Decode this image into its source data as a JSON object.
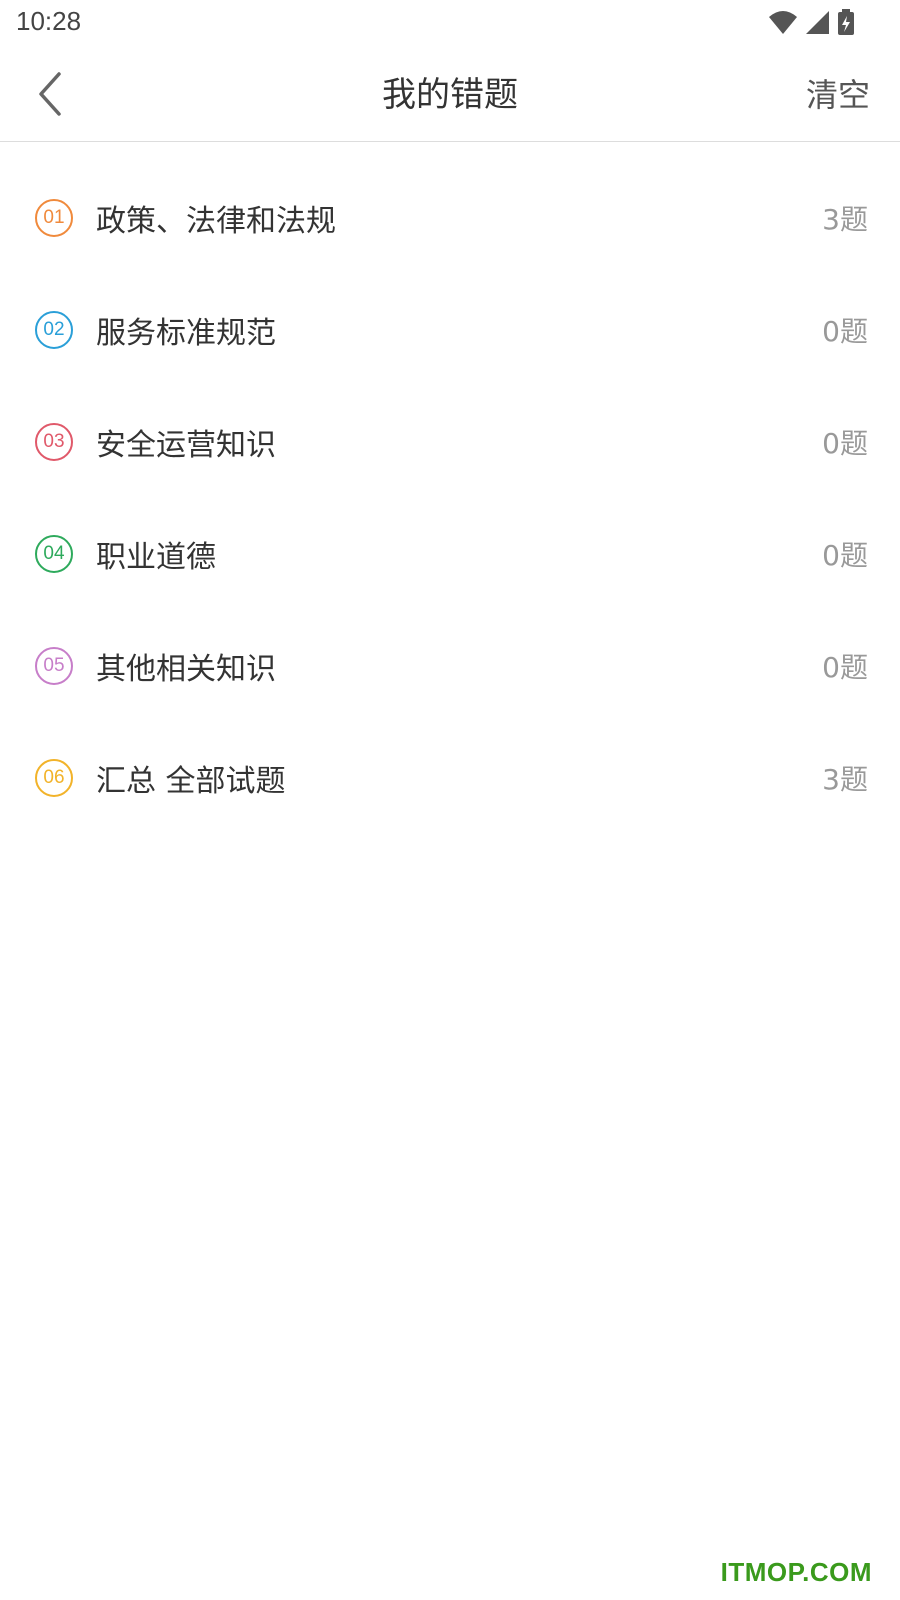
{
  "status_bar": {
    "time": "10:28",
    "icons": [
      "wifi-icon",
      "signal-icon",
      "battery-charging-icon"
    ]
  },
  "header": {
    "title": "我的错题",
    "back_icon": "chevron-left-icon",
    "clear_label": "清空"
  },
  "categories": [
    {
      "number": "01",
      "label": "政策、法律和法规",
      "count": "3题",
      "color": "#f08a3c"
    },
    {
      "number": "02",
      "label": "服务标准规范",
      "count": "0题",
      "color": "#2a9fd8"
    },
    {
      "number": "03",
      "label": "安全运营知识",
      "count": "0题",
      "color": "#e0596a"
    },
    {
      "number": "04",
      "label": "职业道德",
      "count": "0题",
      "color": "#2eaa5c"
    },
    {
      "number": "05",
      "label": "其他相关知识",
      "count": "0题",
      "color": "#c77ec9"
    },
    {
      "number": "06",
      "label": "汇总 全部试题",
      "count": "3题",
      "color": "#f2b32a"
    }
  ],
  "watermark": "ITMOP.COM"
}
